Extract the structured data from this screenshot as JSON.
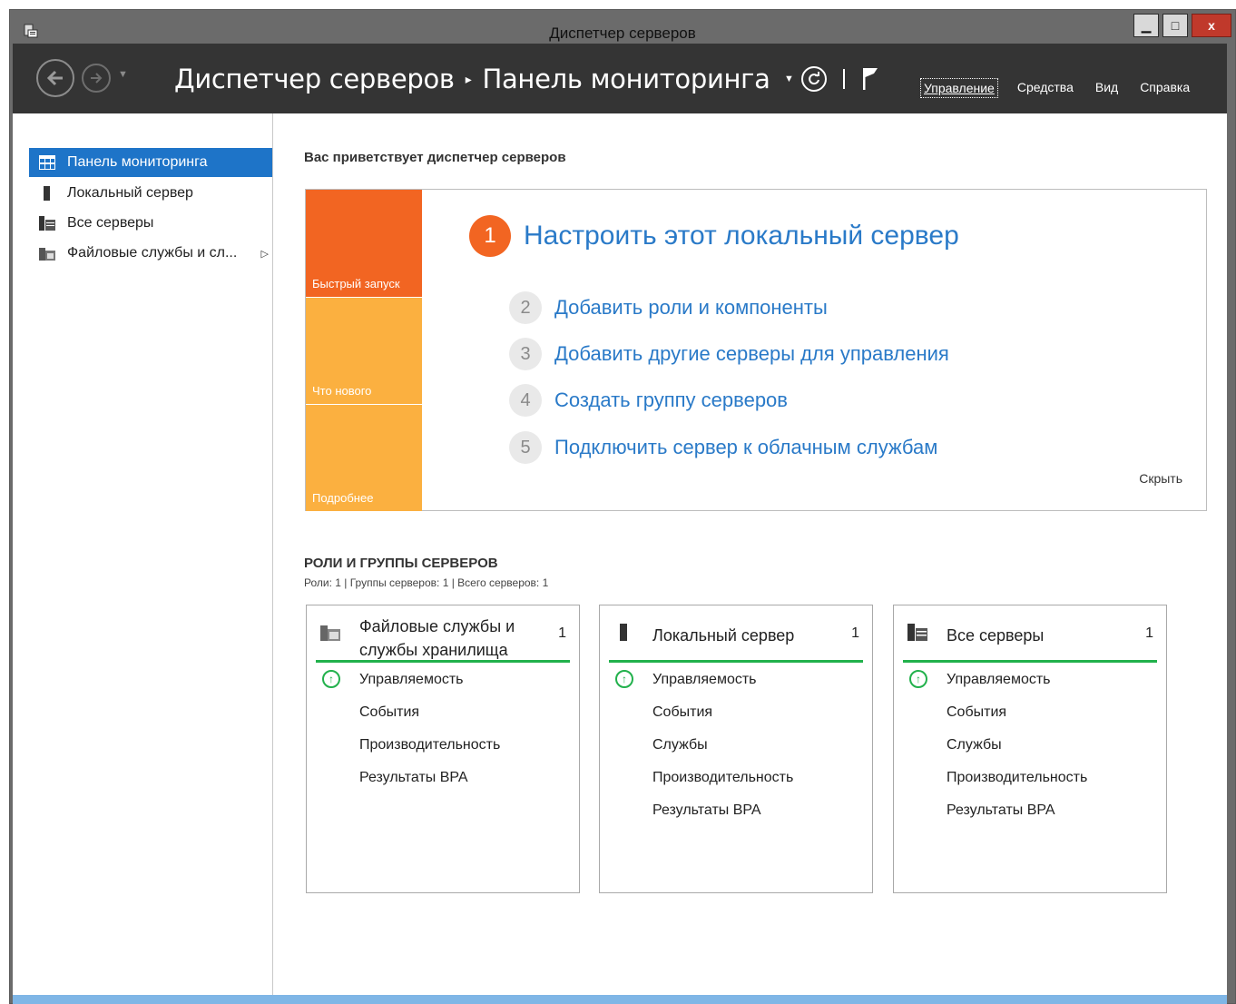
{
  "window": {
    "title": "Диспетчер серверов",
    "minimize_glyph": "▁",
    "maximize_glyph": "□",
    "close_glyph": "x"
  },
  "header": {
    "breadcrumb_root": "Диспетчер серверов",
    "breadcrumb_separator": "▸",
    "breadcrumb_current": "Панель мониторинга",
    "menu": [
      "Управление",
      "Средства",
      "Вид",
      "Справка"
    ]
  },
  "sidebar": {
    "items": [
      {
        "label": "Панель мониторинга",
        "icon": "dashboard-grid-icon",
        "active": true
      },
      {
        "label": "Локальный сервер",
        "icon": "server-icon",
        "active": false
      },
      {
        "label": "Все серверы",
        "icon": "servers-icon",
        "active": false
      },
      {
        "label": "Файловые службы и сл...",
        "icon": "file-services-icon",
        "active": false
      }
    ]
  },
  "welcome": {
    "title": "Вас приветствует диспетчер серверов",
    "tiles": [
      "Быстрый запуск",
      "Что нового",
      "Подробнее"
    ],
    "main_step": {
      "num": "1",
      "label": "Настроить этот локальный сервер"
    },
    "steps": [
      {
        "num": "2",
        "label": "Добавить роли и компоненты"
      },
      {
        "num": "3",
        "label": "Добавить другие серверы для управления"
      },
      {
        "num": "4",
        "label": "Создать группу серверов"
      },
      {
        "num": "5",
        "label": "Подключить сервер к облачным службам"
      }
    ],
    "hide_label": "Скрыть"
  },
  "roles": {
    "title": "РОЛИ И ГРУППЫ СЕРВЕРОВ",
    "subtitle": "Роли: 1 | Группы серверов: 1 | Всего серверов: 1",
    "cards": [
      {
        "title": "Файловые службы и службы хранилища",
        "count": "1",
        "icon": "file-services-icon",
        "rows": [
          "Управляемость",
          "События",
          "Производительность",
          "Результаты BPA"
        ]
      },
      {
        "title": "Локальный сервер",
        "count": "1",
        "icon": "server-icon",
        "rows": [
          "Управляемость",
          "События",
          "Службы",
          "Производительность",
          "Результаты BPA"
        ]
      },
      {
        "title": "Все серверы",
        "count": "1",
        "icon": "servers-icon",
        "rows": [
          "Управляемость",
          "События",
          "Службы",
          "Производительность",
          "Результаты BPA"
        ]
      }
    ]
  },
  "colors": {
    "accent_blue": "#1e74c8",
    "link_blue": "#2a7ac8",
    "orange": "#f26522",
    "light_orange": "#fbb040",
    "status_green": "#22b14c",
    "header_dark": "#343434"
  }
}
